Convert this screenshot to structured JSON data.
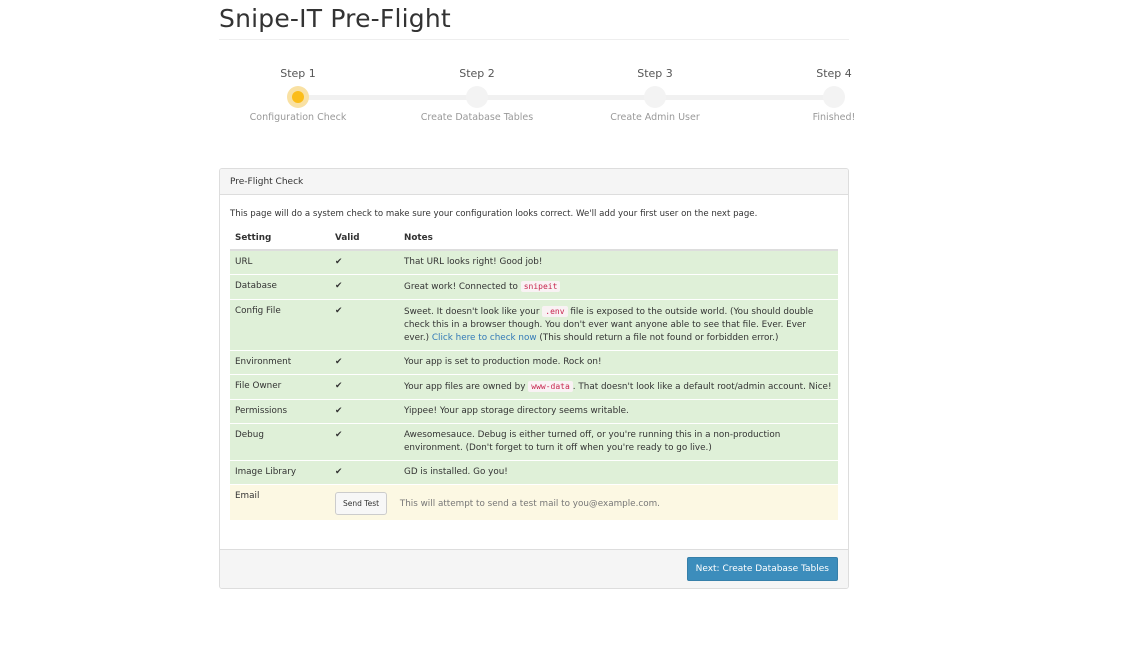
{
  "page": {
    "title": "Snipe-IT Pre-Flight"
  },
  "steps": [
    {
      "num": "Step 1",
      "label": "Configuration Check",
      "active": true
    },
    {
      "num": "Step 2",
      "label": "Create Database Tables",
      "active": false
    },
    {
      "num": "Step 3",
      "label": "Create Admin User",
      "active": false
    },
    {
      "num": "Step 4",
      "label": "Finished!",
      "active": false
    }
  ],
  "colors": {
    "step_active": "#fbbd1a",
    "ok_row": "#dff0d8",
    "warn_row": "#fcf8e3",
    "primary": "#3c8dbc"
  },
  "panel": {
    "heading": "Pre-Flight Check",
    "intro": "This page will do a system check to make sure your configuration looks correct. We'll add your first user on the next page.",
    "columns": {
      "setting": "Setting",
      "valid": "Valid",
      "notes": "Notes"
    },
    "rows": [
      {
        "setting": "URL",
        "valid": "✔",
        "notes": "That URL looks right! Good job!"
      },
      {
        "setting": "Database",
        "valid": "✔",
        "notes_pre": "Great work! Connected to",
        "code": "snipeit"
      },
      {
        "setting": "Config File",
        "valid": "✔",
        "notes_pre": "Sweet. It doesn't look like your",
        "code": ".env",
        "notes_post": "file is exposed to the outside world. (You should double check this in a browser though. You don't ever want anyone able to see that file. Ever. Ever ever.)",
        "link": "Click here to check now",
        "notes_tail": "(This should return a file not found or forbidden error.)"
      },
      {
        "setting": "Environment",
        "valid": "✔",
        "notes": "Your app is set to production mode. Rock on!"
      },
      {
        "setting": "File Owner",
        "valid": "✔",
        "notes_pre": "Your app files are owned by",
        "code": "www-data",
        "notes_post": ". That doesn't look like a default root/admin account. Nice!"
      },
      {
        "setting": "Permissions",
        "valid": "✔",
        "notes": "Yippee! Your app storage directory seems writable."
      },
      {
        "setting": "Debug",
        "valid": "✔",
        "notes": "Awesomesauce. Debug is either turned off, or you're running this in a non-production environment. (Don't forget to turn it off when you're ready to go live.)"
      },
      {
        "setting": "Image Library",
        "valid": "✔",
        "notes": "GD is installed. Go you!"
      },
      {
        "setting": "Email",
        "button": "Send Test",
        "notes": "This will attempt to send a test mail to you@example.com."
      }
    ],
    "next_button": "Next: Create Database Tables"
  }
}
